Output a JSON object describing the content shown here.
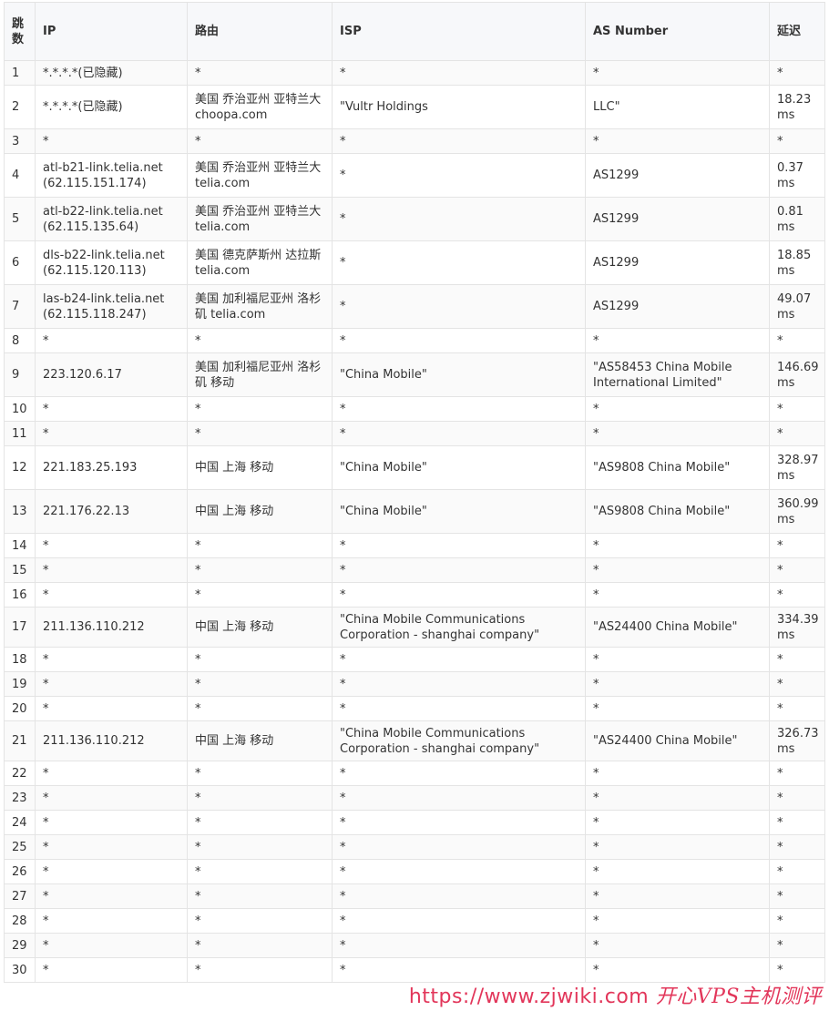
{
  "columns": {
    "hop": "跳数",
    "ip": "IP",
    "route": "路由",
    "isp": "ISP",
    "as": "AS Number",
    "latency": "延迟"
  },
  "rows": [
    {
      "hop": "1",
      "ip": "*.*.*.*(已隐藏)",
      "route": "*",
      "isp": "*",
      "as": "*",
      "latency": "*"
    },
    {
      "hop": "2",
      "ip": "*.*.*.*(已隐藏)",
      "route": "美国 乔治亚州 亚特兰大 choopa.com",
      "isp": "\"Vultr Holdings",
      "as": "LLC\"",
      "latency": "18.23 ms"
    },
    {
      "hop": "3",
      "ip": "*",
      "route": "*",
      "isp": "*",
      "as": "*",
      "latency": "*"
    },
    {
      "hop": "4",
      "ip": "atl-b21-link.telia.net (62.115.151.174)",
      "route": "美国 乔治亚州 亚特兰大 telia.com",
      "isp": "*",
      "as": "AS1299",
      "latency": "0.37 ms"
    },
    {
      "hop": "5",
      "ip": "atl-b22-link.telia.net (62.115.135.64)",
      "route": "美国 乔治亚州 亚特兰大 telia.com",
      "isp": "*",
      "as": "AS1299",
      "latency": "0.81 ms"
    },
    {
      "hop": "6",
      "ip": "dls-b22-link.telia.net (62.115.120.113)",
      "route": "美国 德克萨斯州 达拉斯 telia.com",
      "isp": "*",
      "as": "AS1299",
      "latency": "18.85 ms"
    },
    {
      "hop": "7",
      "ip": "las-b24-link.telia.net (62.115.118.247)",
      "route": "美国 加利福尼亚州 洛杉矶 telia.com",
      "isp": "*",
      "as": "AS1299",
      "latency": "49.07 ms"
    },
    {
      "hop": "8",
      "ip": "*",
      "route": "*",
      "isp": "*",
      "as": "*",
      "latency": "*"
    },
    {
      "hop": "9",
      "ip": "223.120.6.17",
      "route": "美国 加利福尼亚州 洛杉矶 移动",
      "isp": "\"China Mobile\"",
      "as": "\"AS58453 China Mobile International Limited\"",
      "latency": "146.69 ms"
    },
    {
      "hop": "10",
      "ip": "*",
      "route": "*",
      "isp": "*",
      "as": "*",
      "latency": "*"
    },
    {
      "hop": "11",
      "ip": "*",
      "route": "*",
      "isp": "*",
      "as": "*",
      "latency": "*"
    },
    {
      "hop": "12",
      "ip": "221.183.25.193",
      "route": "中国 上海 移动",
      "isp": "\"China Mobile\"",
      "as": "\"AS9808 China Mobile\"",
      "latency": "328.97 ms"
    },
    {
      "hop": "13",
      "ip": "221.176.22.13",
      "route": "中国 上海 移动",
      "isp": "\"China Mobile\"",
      "as": "\"AS9808 China Mobile\"",
      "latency": "360.99 ms"
    },
    {
      "hop": "14",
      "ip": "*",
      "route": "*",
      "isp": "*",
      "as": "*",
      "latency": "*"
    },
    {
      "hop": "15",
      "ip": "*",
      "route": "*",
      "isp": "*",
      "as": "*",
      "latency": "*"
    },
    {
      "hop": "16",
      "ip": "*",
      "route": "*",
      "isp": "*",
      "as": "*",
      "latency": "*"
    },
    {
      "hop": "17",
      "ip": "211.136.110.212",
      "route": "中国 上海 移动",
      "isp": "\"China Mobile Communications Corporation - shanghai company\"",
      "as": "\"AS24400 China Mobile\"",
      "latency": "334.39 ms"
    },
    {
      "hop": "18",
      "ip": "*",
      "route": "*",
      "isp": "*",
      "as": "*",
      "latency": "*"
    },
    {
      "hop": "19",
      "ip": "*",
      "route": "*",
      "isp": "*",
      "as": "*",
      "latency": "*"
    },
    {
      "hop": "20",
      "ip": "*",
      "route": "*",
      "isp": "*",
      "as": "*",
      "latency": "*"
    },
    {
      "hop": "21",
      "ip": "211.136.110.212",
      "route": "中国 上海 移动",
      "isp": "\"China Mobile Communications Corporation - shanghai company\"",
      "as": "\"AS24400 China Mobile\"",
      "latency": "326.73 ms"
    },
    {
      "hop": "22",
      "ip": "*",
      "route": "*",
      "isp": "*",
      "as": "*",
      "latency": "*"
    },
    {
      "hop": "23",
      "ip": "*",
      "route": "*",
      "isp": "*",
      "as": "*",
      "latency": "*"
    },
    {
      "hop": "24",
      "ip": "*",
      "route": "*",
      "isp": "*",
      "as": "*",
      "latency": "*"
    },
    {
      "hop": "25",
      "ip": "*",
      "route": "*",
      "isp": "*",
      "as": "*",
      "latency": "*"
    },
    {
      "hop": "26",
      "ip": "*",
      "route": "*",
      "isp": "*",
      "as": "*",
      "latency": "*"
    },
    {
      "hop": "27",
      "ip": "*",
      "route": "*",
      "isp": "*",
      "as": "*",
      "latency": "*"
    },
    {
      "hop": "28",
      "ip": "*",
      "route": "*",
      "isp": "*",
      "as": "*",
      "latency": "*"
    },
    {
      "hop": "29",
      "ip": "*",
      "route": "*",
      "isp": "*",
      "as": "*",
      "latency": "*"
    },
    {
      "hop": "30",
      "ip": "*",
      "route": "*",
      "isp": "*",
      "as": "*",
      "latency": "*"
    }
  ],
  "watermark": {
    "url": "https://www.zjwiki.com",
    "cn": "开心VPS主机测评"
  }
}
